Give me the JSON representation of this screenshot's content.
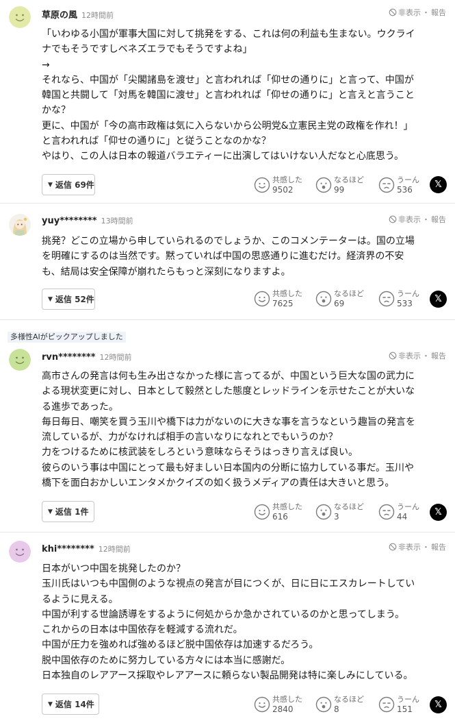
{
  "ui": {
    "hide_label": "非表示",
    "separator": "・",
    "report_label": "報告"
  },
  "pickup_label": "多様性AIがピックアップしました",
  "comments": [
    {
      "username": "草原の風",
      "time": "12時間前",
      "lines": [
        "「いわゆる小国が軍事大国に対して挑発をする、これは何の利益も生まない。ウクライ",
        "ナでもそうですしベネズエラでもそうですよね」",
        "→",
        "それなら、中国が「尖閣諸島を渡せ」と言われれば「仰せの通りに」と言って、中国が",
        "韓国と共闘して「対馬を韓国に渡せ」と言われれば「仰せの通りに」と言えと言うこと",
        "かな？",
        "更に、中国が「今の高市政権は気に入らないから公明党&立憲民主党の政権を作れ！」",
        "と言われれば「仰せの通りに」と従うことなのかな？",
        "やはり、この人は日本の報道バラエティーに出演してはいけない人だなと心底思う。"
      ],
      "reply_label": "返信 69件",
      "reactions": [
        {
          "label": "共感した",
          "count": "9502"
        },
        {
          "label": "なるほど",
          "count": "99"
        },
        {
          "label": "うーん",
          "count": "536"
        }
      ]
    },
    {
      "username": "yuy********",
      "time": "13時間前",
      "lines": [
        "挑発？どこの立場から申していられるのでしょうか、このコメンテーターは。国の立場",
        "を明確にするのは当然です。黙っていれば中国の思惑通りに進むだけ。経済界の不安",
        "も、結局は安全保障が崩れたらもっと深刻になりますよ。"
      ],
      "reply_label": "返信 52件",
      "reactions": [
        {
          "label": "共感した",
          "count": "7625"
        },
        {
          "label": "なるほど",
          "count": "69"
        },
        {
          "label": "うーん",
          "count": "533"
        }
      ]
    },
    {
      "username": "rvn********",
      "time": "12時間前",
      "lines": [
        "高市さんの発言は何も生み出さなかった様に言ってるが、中国という巨大な国の武力に",
        "よる現状変更に対し、日本として毅然とした態度とレッドラインを示せたことが大いな",
        "る進歩であった。",
        "毎日毎日、嘲笑を買う玉川や橋下は力がないのに大きな事を言うなという趣旨の発言を",
        "流しているが、力がなければ相手の言いなりになれとでもいうのか？",
        "力をつけるために核武装をしろという意味ならそうはっきり言えば良い。",
        "彼らのいう事は中国にとって最も好ましい日本国内の分断に協力している事だ。玉川や",
        "橋下を面白おかしいエンタメかクイズの如く扱うメディアの責任は大きいと思う。"
      ],
      "reply_label": "返信 1件",
      "reactions": [
        {
          "label": "共感した",
          "count": "616"
        },
        {
          "label": "なるほど",
          "count": "3"
        },
        {
          "label": "うーん",
          "count": "44"
        }
      ]
    },
    {
      "username": "khi********",
      "time": "12時間前",
      "lines": [
        "日本がいつ中国を挑発したのか？",
        "玉川氏はいつも中国側のような視点の発言が目につくが、日に日にエスカレートしてい",
        "るように見える。",
        "中国が利する世論誘導をするように何処からか急かされているのかと思ってしまう。",
        "これからの日本は中国依存を軽減する流れだ。",
        "中国が圧力を強めれば強めるほど脱中国依存は加速するだろう。",
        "脱中国依存のために努力している方々には本当に感謝だ。",
        "日本独自のレアアース採取やレアアースに頼らない製品開発は特に楽しみにしている。"
      ],
      "reply_label": "返信 14件",
      "reactions": [
        {
          "label": "共感した",
          "count": "2840"
        },
        {
          "label": "なるほど",
          "count": "8"
        },
        {
          "label": "うーん",
          "count": "151"
        }
      ]
    }
  ],
  "x_share_label": "𝕏",
  "colors": {
    "avatar_yellow": "#e3eaa8",
    "avatar_green": "#c9e29a",
    "avatar_pink": "#e9c9ea",
    "face": "#8a8f57"
  }
}
